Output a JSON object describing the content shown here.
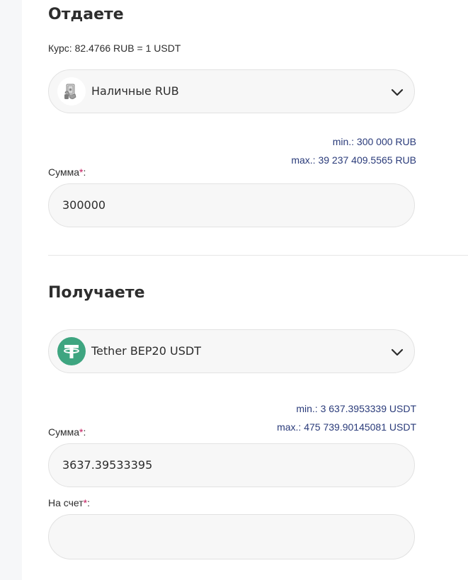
{
  "give": {
    "title": "Отдаете",
    "rate": "Курс: 82.4766 RUB = 1 USDT",
    "currency": {
      "label": "Наличные RUB",
      "icon": "cash-hand-icon"
    },
    "limits": {
      "min": "min.: 300 000 RUB",
      "max": "max.: 39 237 409.5565 RUB"
    },
    "amount": {
      "label": "Сумма",
      "required_mark": "*",
      "value": "300000"
    }
  },
  "receive": {
    "title": "Получаете",
    "currency": {
      "label": "Tether BEP20 USDT",
      "icon": "tether-icon"
    },
    "limits": {
      "min": "min.: 3 637.3953339 USDT",
      "max": "max.: 475 739.90145081 USDT"
    },
    "amount": {
      "label": "Сумма",
      "required_mark": "*",
      "value": "3637.39533395"
    },
    "account": {
      "label": "На счет",
      "required_mark": "*",
      "value": ""
    }
  },
  "colors": {
    "limit_text": "#2a3b7a",
    "required": "#c2185b",
    "tether": "#3ea580",
    "field_bg": "#f7f7f7",
    "field_border": "#e2e2e2"
  }
}
